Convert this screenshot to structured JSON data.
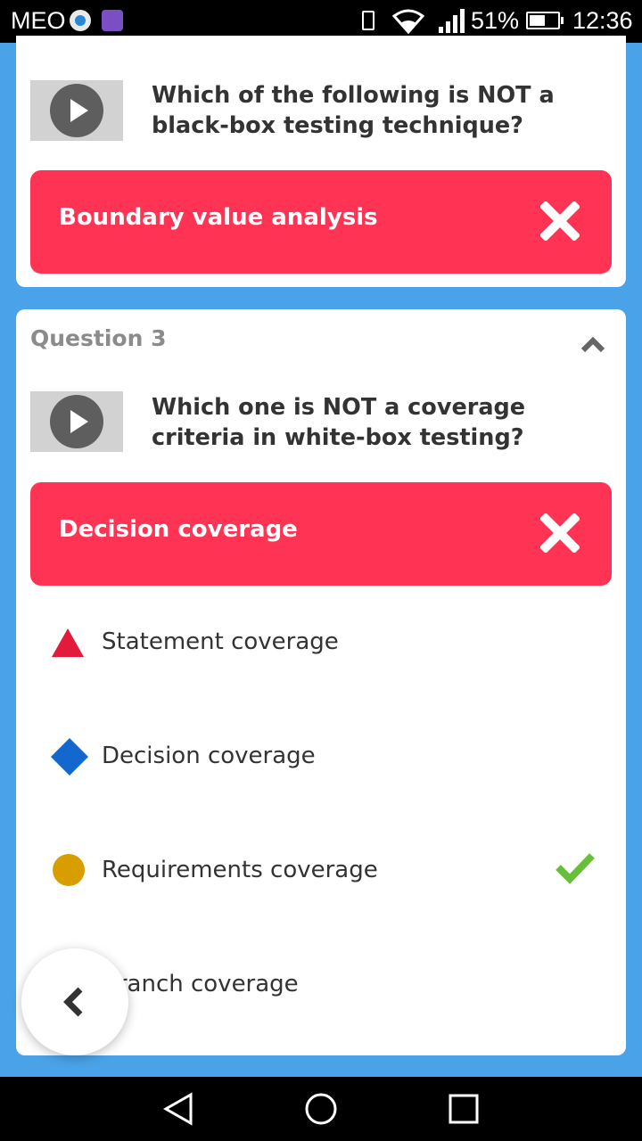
{
  "status_bar": {
    "carrier": "MEO",
    "battery": "51%",
    "time": "12:36",
    "icons": [
      "app-icon",
      "app-icon",
      "vibrate-icon",
      "wifi-icon",
      "signal-icon",
      "battery-icon"
    ]
  },
  "previous_question": {
    "text": "Which of the following is NOT a black-box testing technique?",
    "user_answer": "Boundary value analysis",
    "result": "wrong"
  },
  "question_3": {
    "label": "Question 3",
    "text": "Which one is NOT a coverage criteria in white-box testing?",
    "user_answer": "Decision coverage",
    "result": "wrong",
    "options": [
      {
        "shape": "triangle",
        "color": "#e21b3c",
        "label": "Statement coverage",
        "correct": false
      },
      {
        "shape": "diamond",
        "color": "#1368ce",
        "label": "Decision coverage",
        "correct": false
      },
      {
        "shape": "circle",
        "color": "#d89e00",
        "label": "Requirements coverage",
        "correct": true
      },
      {
        "shape": "square",
        "color": "#26890c",
        "label": "Branch coverage",
        "correct": false
      }
    ]
  },
  "colors": {
    "background": "#4aa3e8",
    "wrong": "#ff3455",
    "correct": "#66bf39"
  }
}
